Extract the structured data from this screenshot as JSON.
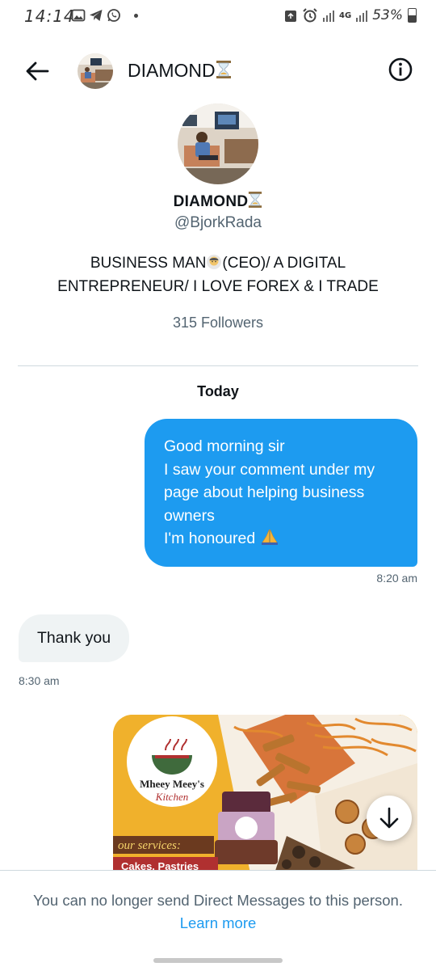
{
  "status_bar": {
    "time": "14:14",
    "network": "4G",
    "battery": "53%"
  },
  "header": {
    "title": "DIAMOND",
    "back_icon": "arrow-left-icon",
    "info_icon": "info-icon"
  },
  "profile": {
    "name": "DIAMOND",
    "handle": "@BjorkRada",
    "bio_line1": "BUSINESS MAN",
    "bio_line1_rest": "(CEO)/ A DIGITAL",
    "bio_line2": "ENTREPRENEUR/ I LOVE FOREX & I TRADE",
    "followers": "315 Followers"
  },
  "conversation": {
    "day_label": "Today",
    "messages": [
      {
        "direction": "outgoing",
        "lines": [
          "Good morning sir",
          "I saw your comment under my",
          "page about helping business",
          "owners",
          "I'm honoured"
        ],
        "time": "8:20 am"
      },
      {
        "direction": "incoming",
        "text": "Thank you",
        "time": "8:30 am"
      }
    ],
    "image_message": {
      "brand_line1": "Mheey Meey's",
      "brand_line2": "Kitchen",
      "services": "our services:",
      "services_items": "Cakes, Pastries"
    }
  },
  "footer": {
    "notice": "You can no longer send Direct Messages to this person.",
    "link": "Learn more"
  },
  "colors": {
    "accent": "#1d9bf0",
    "muted": "#536471",
    "incoming_bubble": "#eff3f4"
  }
}
